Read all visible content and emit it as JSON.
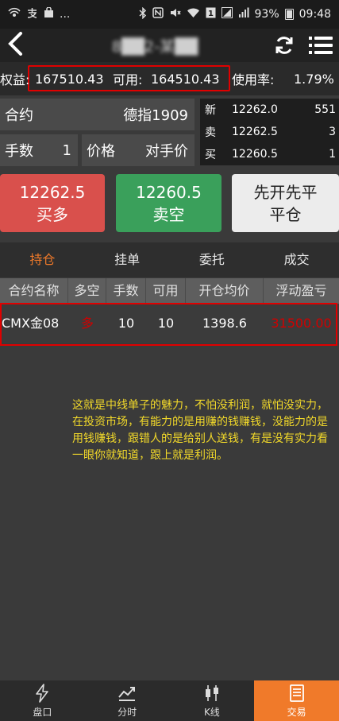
{
  "status_bar": {
    "left_icons": [
      "wifi-hotspot-icon",
      "alipay-icon",
      "shopping-bag-icon",
      "more-dots-icon"
    ],
    "more": "...",
    "battery": "93%",
    "time": "09:48"
  },
  "nav": {
    "title": "8██2-某██"
  },
  "account": {
    "equity_label": "权益:",
    "equity_value": "167510.43",
    "available_label": "可用:",
    "available_value": "164510.43",
    "usage_label": "使用率:",
    "usage_value": "1.79%"
  },
  "order_form": {
    "contract_label": "合约",
    "contract_value": "德指1909",
    "lots_label": "手数",
    "lots_value": "1",
    "price_label": "价格",
    "price_value": "对手价"
  },
  "quote": {
    "rows": [
      {
        "label": "新",
        "price": "12262.0",
        "volume": "551"
      },
      {
        "label": "卖",
        "price": "12262.5",
        "volume": "3"
      },
      {
        "label": "买",
        "price": "12260.5",
        "volume": "1"
      }
    ]
  },
  "buttons": {
    "buy_price": "12262.5",
    "buy_label": "买多",
    "sell_price": "12260.5",
    "sell_label": "卖空",
    "close_line1": "先开先平",
    "close_line2": "平仓"
  },
  "tabs": [
    {
      "label": "持仓",
      "active": true
    },
    {
      "label": "挂单",
      "active": false
    },
    {
      "label": "委托",
      "active": false
    },
    {
      "label": "成交",
      "active": false
    }
  ],
  "positions": {
    "headers": [
      "合约名称",
      "多空",
      "手数",
      "可用",
      "开仓均价",
      "浮动盈亏"
    ],
    "rows": [
      {
        "contract": "CMX金08",
        "direction": "多",
        "lots": "10",
        "available": "10",
        "avg_price": "1398.6",
        "pnl": "31500.00"
      }
    ]
  },
  "note": "这就是中线单子的魅力，不怕没利润，就怕没实力，在投资市场，有能力的是用赚的钱赚钱，没能力的是用钱赚钱，跟错人的是给别人送钱，有是没有实力看一眼你就知道，跟上就是利润。",
  "bottom_nav": [
    {
      "label": "盘口",
      "icon": "lightning-icon",
      "active": false
    },
    {
      "label": "分时",
      "icon": "trend-line-icon",
      "active": false
    },
    {
      "label": "K线",
      "icon": "candlestick-icon",
      "active": false
    },
    {
      "label": "交易",
      "icon": "document-icon",
      "active": true
    }
  ],
  "colors": {
    "accent": "#f07a2a",
    "buy": "#d9504c",
    "sell": "#3aa05b",
    "loss_profit": "#d00000",
    "highlight_box": "#e00000",
    "note_text": "#f2d92a"
  }
}
